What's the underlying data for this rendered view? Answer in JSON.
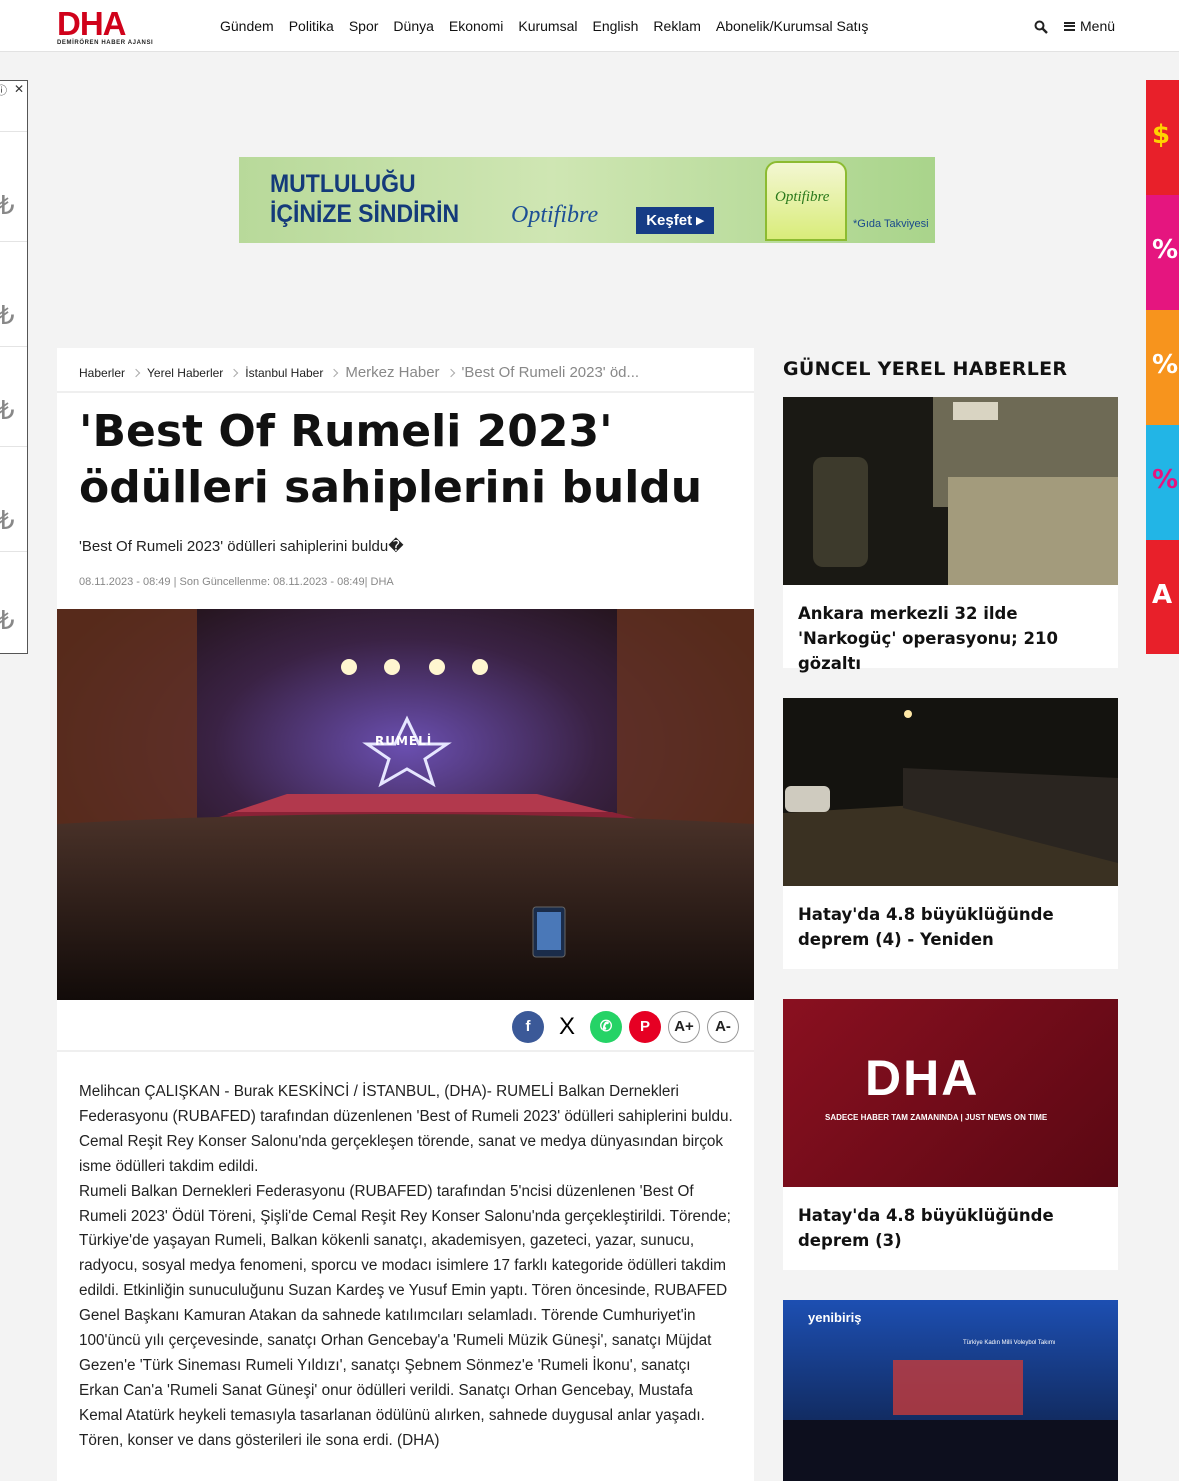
{
  "header": {
    "logo": "DHA",
    "logo_sub": "DEMİRÖREN HABER AJANSI",
    "nav": [
      "Gündem",
      "Politika",
      "Spor",
      "Dünya",
      "Ekonomi",
      "Kurumsal",
      "English",
      "Reklam",
      "Abonelik/Kurumsal Satış"
    ],
    "menu_label": "Menü",
    "icons": {
      "search": "search-icon",
      "menu": "hamburger-icon"
    }
  },
  "ad_banner": {
    "headline_1": "MUTLULUĞU",
    "headline_2": "İÇİNİZE SİNDİRİN",
    "brand": "Optifibre",
    "cta": "Keşfet ▸",
    "product_label": "Optifibre",
    "note": "*Gıda Takviyesi"
  },
  "left_ad": {
    "close": "✕",
    "info": "ⓘ"
  },
  "breadcrumb": [
    "Haberler",
    "Yerel Haberler",
    "İstanbul Haber",
    "Merkez Haber",
    "'Best Of Rumeli 2023' öd..."
  ],
  "article": {
    "title": "'Best Of Rumeli 2023' ödülleri sahiplerini buldu",
    "spot": "'Best Of Rumeli 2023' ödülleri sahiplerini buldu�",
    "meta": "08.11.2023 - 08:49 | Son Güncellenme: 08.11.2023 - 08:49| DHA",
    "stage_sign": "RUMELİ",
    "body_1": "Melihcan ÇALIŞKAN - Burak KESKİNCİ / İSTANBUL, (DHA)- RUMELİ Balkan Dernekleri Federasyonu (RUBAFED) tarafından düzenlenen 'Best of Rumeli 2023' ödülleri sahiplerini buldu. Cemal Reşit Rey Konser Salonu'nda gerçekleşen törende, sanat ve medya dünyasından birçok isme ödülleri takdim edildi.",
    "body_2": "Rumeli Balkan Dernekleri Federasyonu (RUBAFED) tarafından 5'ncisi düzenlenen 'Best Of Rumeli 2023' Ödül Töreni, Şişli'de Cemal Reşit Rey Konser Salonu'nda gerçekleştirildi. Törende; Türkiye'de yaşayan Rumeli, Balkan kökenli sanatçı, akademisyen, gazeteci, yazar, sunucu, radyocu, sosyal medya fenomeni, sporcu ve modacı isimlere 17 farklı kategoride ödülleri takdim edildi. Etkinliğin sunuculuğunu Suzan Kardeş ve Yusuf Emin yaptı. Tören öncesinde, RUBAFED Genel Başkanı Kamuran Atakan da sahnede katılımcıları selamladı. Törende Cumhuriyet'in 100'üncü yılı çerçevesinde, sanatçı Orhan Gencebay'a 'Rumeli Müzik Güneşi', sanatçı Müjdat Gezen'e 'Türk Sineması Rumeli Yıldızı', sanatçı Şebnem Sönmez'e 'Rumeli İkonu', sanatçı Erkan Can'a 'Rumeli Sanat Güneşi' onur ödülleri verildi. Sanatçı Orhan Gencebay, Mustafa Kemal Atatürk heykeli temasıyla tasarlanan ödülünü alırken, sahnede duygusal anlar yaşadı. Tören, konser ve dans gösterileri ile sona erdi. (DHA)",
    "share": {
      "facebook": "f",
      "x": "X",
      "whatsapp": "✆",
      "pinterest": "P",
      "font_up": "A+",
      "font_down": "A-"
    }
  },
  "sidebar": {
    "heading": "GÜNCEL YEREL HABERLER",
    "items": [
      {
        "title": "Ankara merkezli 32 ilde 'Narkogüç' operasyonu; 210 gözaltı"
      },
      {
        "title": "Hatay'da 4.8 büyüklüğünde deprem (4) - Yeniden"
      },
      {
        "title": "Hatay'da 4.8 büyüklüğünde deprem (3)",
        "logo": "DHA",
        "tagline": "SADECE HABER TAM ZAMANINDA | JUST NEWS ON TIME"
      },
      {
        "title": "",
        "brand": "yenibiriş",
        "banner": "Türkiye Kadın Milli Voleybol Takımı"
      }
    ]
  },
  "colors": {
    "brand_red": "#d0021b",
    "facebook": "#3b5998",
    "whatsapp": "#25d366",
    "pinterest": "#e60023"
  }
}
